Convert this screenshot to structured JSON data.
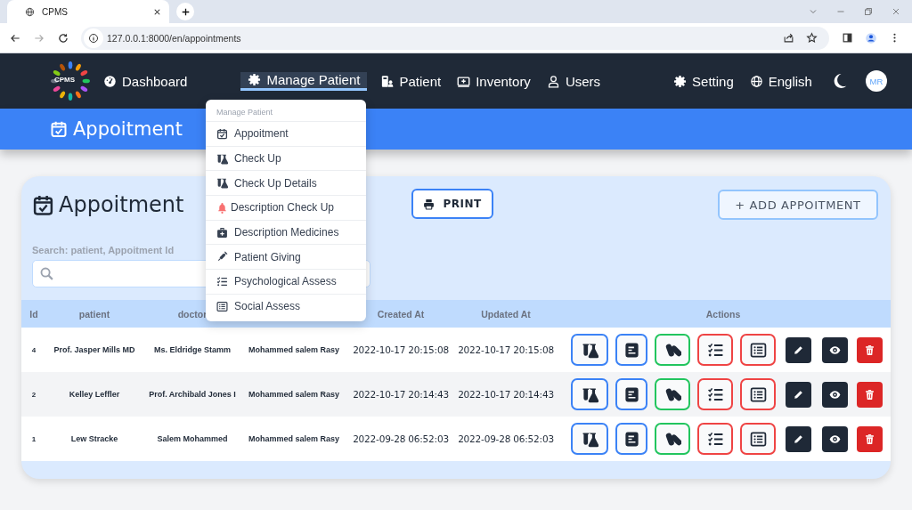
{
  "browser": {
    "tab_title": "CPMS",
    "url": "127.0.0.1:8000/en/appointments"
  },
  "nav": {
    "logo": "CPMS",
    "items": [
      {
        "label": "Dashboard",
        "selected": false
      },
      {
        "label": "Manage Patient",
        "selected": true
      },
      {
        "label": "Patient",
        "selected": false
      },
      {
        "label": "Inventory",
        "selected": false
      },
      {
        "label": "Users",
        "selected": false
      }
    ],
    "right": [
      {
        "label": "Setting"
      },
      {
        "label": "English"
      }
    ],
    "avatar": "MR"
  },
  "page_title": "Appoitment",
  "dropdown": {
    "header": "Manage Patient",
    "items": [
      "Appoitment",
      "Check Up",
      "Check Up Details",
      "Description Check Up",
      "Description Medicines",
      "Patient Giving",
      "Psychological Assess",
      "Social Assess"
    ]
  },
  "card": {
    "title": "Appoitment",
    "print": "PRINT",
    "add": "+ ADD APPOITMENT",
    "search_label": "Search: patient, Appoitment Id"
  },
  "table": {
    "columns": [
      {
        "label": "Id"
      },
      {
        "label": "patient"
      },
      {
        "label": "doctor"
      },
      {},
      {
        "label": "Created At"
      },
      {
        "label": "Updated At"
      },
      {
        "label": "Actions"
      }
    ],
    "rows": [
      {
        "cells": [
          "4",
          "Prof. Jasper Mills MD",
          "Ms. Eldridge Stamm",
          "Mohammed salem Rasy",
          "2022-10-17 20:15:08",
          "2022-10-17 20:15:08"
        ]
      },
      {
        "cells": [
          "2",
          "Kelley Leffler",
          "Prof. Archibald Jones I",
          "Mohammed salem Rasy",
          "2022-10-17 20:14:43",
          "2022-10-17 20:14:43"
        ]
      },
      {
        "cells": [
          "1",
          "Lew Stracke",
          "Salem Mohammed",
          "Mohammed salem Rasy",
          "2022-09-28 06:52:03",
          "2022-09-28 06:52:03"
        ]
      }
    ],
    "actions": [
      {
        "kind": "outline",
        "color": "#3b82f6"
      },
      {
        "kind": "outline",
        "color": "#3b82f6"
      },
      {
        "kind": "outline",
        "color": "#22c55e"
      },
      {
        "kind": "outline",
        "color": "#ef4444"
      },
      {
        "kind": "outline",
        "color": "#ef4444"
      },
      {
        "kind": "solid",
        "color": "#1f2937"
      },
      {
        "kind": "solid",
        "color": "#1f2937"
      },
      {
        "kind": "solid",
        "color": "#dc2626"
      }
    ]
  }
}
